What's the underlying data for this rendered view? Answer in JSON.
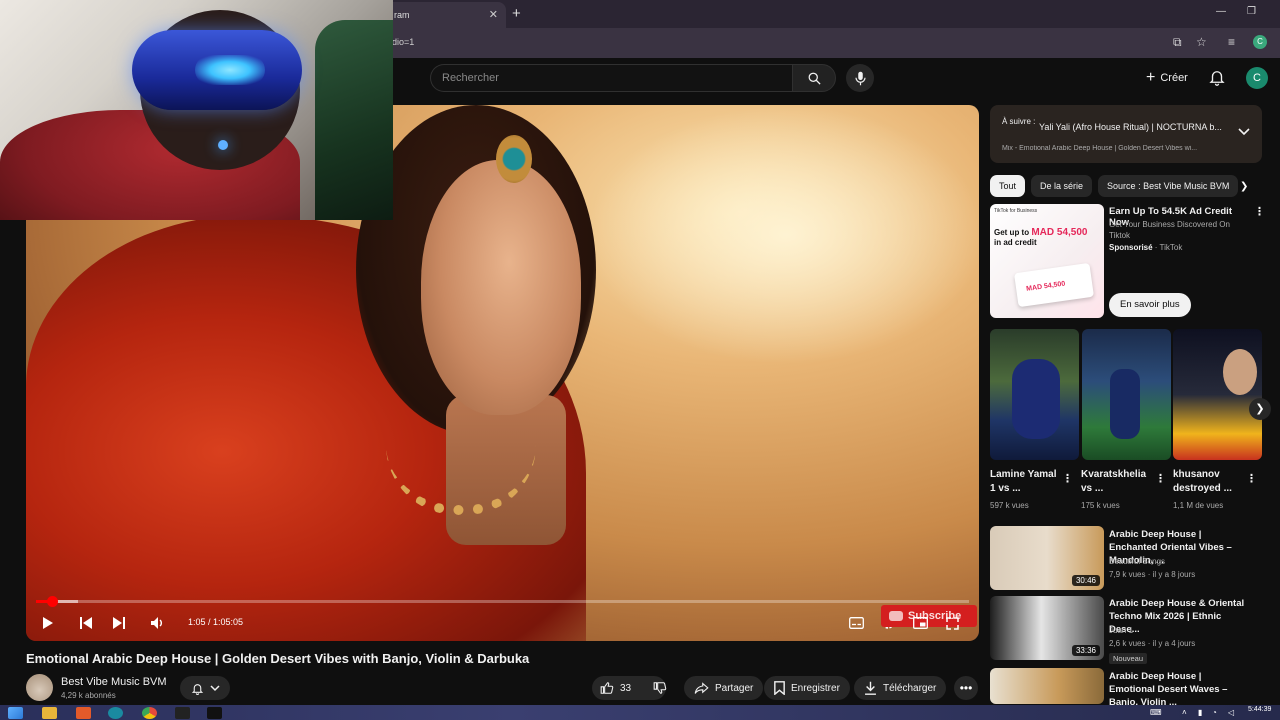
{
  "browser": {
    "tab_title": "ram",
    "url": "dio=1"
  },
  "header": {
    "search_placeholder": "Rechercher",
    "create_label": "Créer",
    "avatar_letter": "C"
  },
  "player": {
    "time": "1:05 / 1:05:05",
    "progress_percent": 1.7,
    "watermark_label": "Subscribe"
  },
  "video": {
    "title": "Emotional Arabic Deep House | Golden Desert Vibes with Banjo, Violin & Darbuka",
    "channel_name": "Best Vibe Music BVM",
    "subscribers": "4,29 k abonnés",
    "like_count": "33",
    "share_label": "Partager",
    "save_label": "Enregistrer",
    "download_label": "Télécharger"
  },
  "up_next": {
    "label": "À suivre :",
    "title": "Yali Yali (Afro House Ritual) | NOCTURNA b...",
    "subtitle": "Mix - Emotional Arabic Deep House | Golden Desert Vibes wi..."
  },
  "chips": [
    {
      "label": "Tout"
    },
    {
      "label": "De la série"
    },
    {
      "label": "Source : Best Vibe Music BVM"
    }
  ],
  "ad": {
    "brand_label": "TikTok for Business",
    "headline_prefix": "Get up to",
    "headline_amount": "MAD 54,500",
    "headline_suffix": "in ad credit",
    "coupon_amount": "MAD 54,500",
    "title": "Earn Up To 54.5K Ad Credit Now",
    "description": "Get Your Business Discovered On Tiktok",
    "sponsored": "Sponsorisé",
    "advertiser": "TikTok",
    "cta": "En savoir plus"
  },
  "shorts": [
    {
      "title": "Lamine Yamal 1 vs ...",
      "views": "597 k vues"
    },
    {
      "title": "Kvaratskhelia vs ...",
      "views": "175 k vues"
    },
    {
      "title": "khusanov destroyed ...",
      "views": "1,1 M de vues"
    }
  ],
  "recommendations": [
    {
      "title": "Arabic Deep House | Enchanted Oriental Vibes – Mandolin, ...",
      "channel": "Beautiful Songs",
      "meta": "7,9 k vues · il y a 8 jours",
      "duration": "30:46"
    },
    {
      "title": "Arabic Deep House & Oriental Techno Mix 2026 | Ethnic Dese...",
      "channel": "Juan 1",
      "meta": "2,6 k vues · il y a 4 jours",
      "duration": "33:36",
      "badge": "Nouveau"
    },
    {
      "title": "Arabic Deep House | Emotional Desert Waves – Banjo, Violin ...",
      "channel": "Beautiful Songs",
      "meta": "",
      "duration": ""
    }
  ],
  "taskbar": {
    "clock": "5:44:39"
  },
  "colors": {
    "accent": "#ff0000",
    "background": "#0f0f0f",
    "avatar": "#1a8a6d"
  },
  "icons": [
    "search-icon",
    "mic-icon",
    "plus-icon",
    "bell-icon",
    "play-icon",
    "prev-icon",
    "next-icon",
    "volume-icon",
    "subtitles-icon",
    "settings-icon",
    "miniplayer-icon",
    "fullscreen-icon",
    "like-icon",
    "dislike-icon",
    "share-icon",
    "save-icon",
    "download-icon",
    "more-icon",
    "chevron-down-icon",
    "chevron-right-icon"
  ]
}
